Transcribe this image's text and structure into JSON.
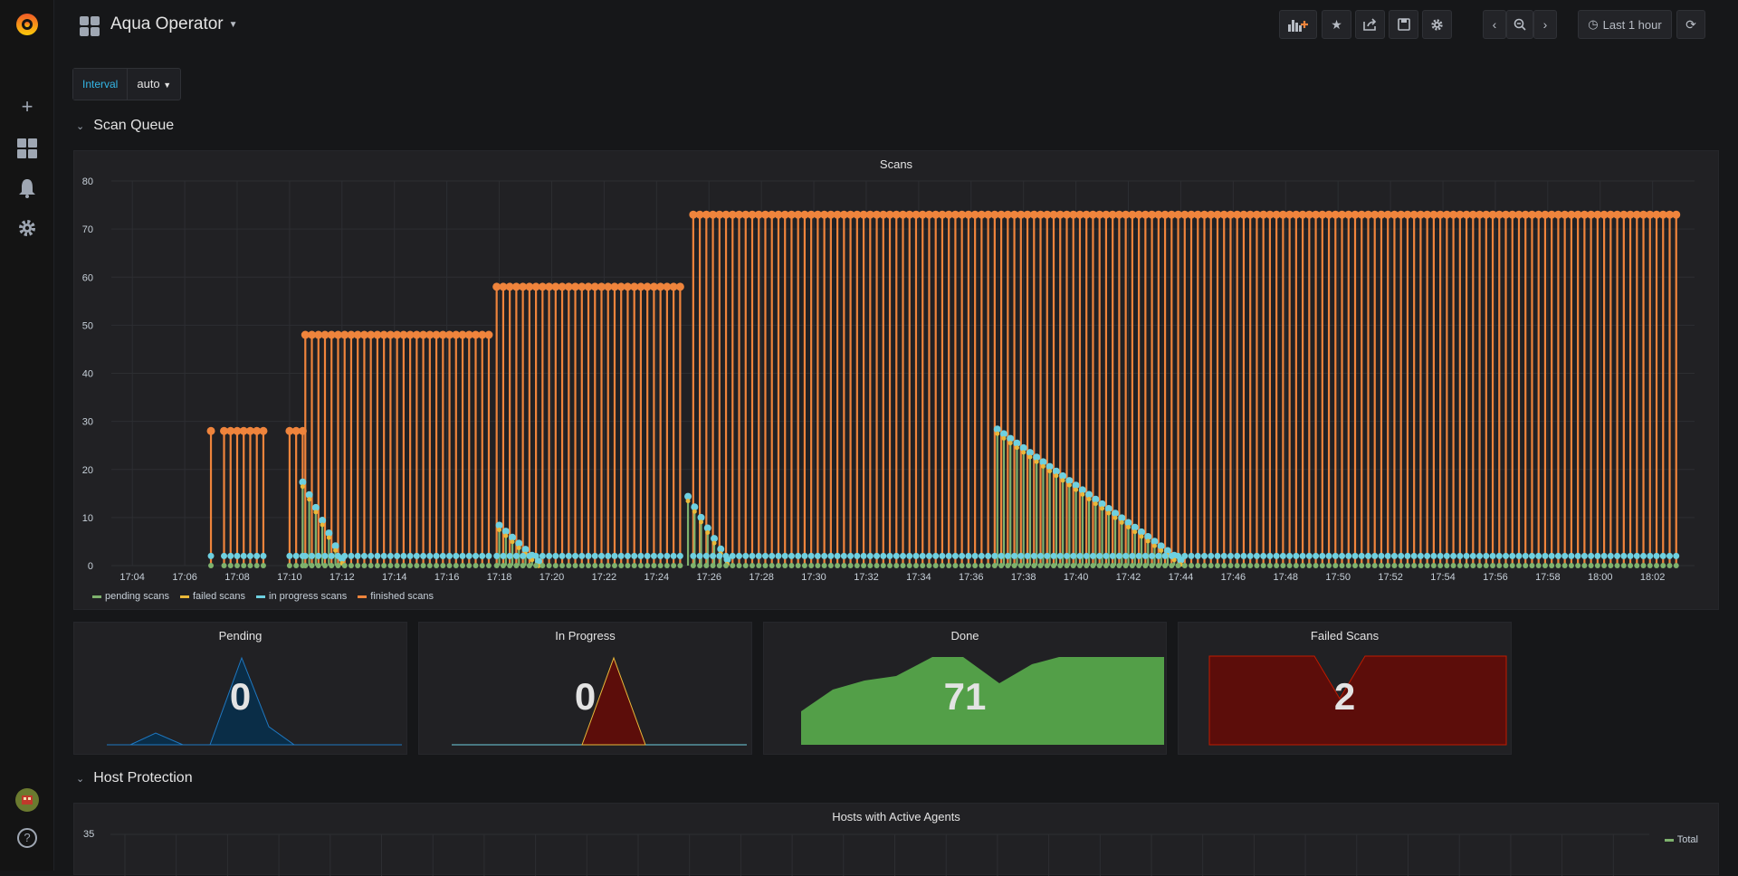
{
  "sidebar": {
    "logo": "grafana-logo",
    "items": [
      {
        "name": "create",
        "icon": "plus-icon",
        "glyph": "+"
      },
      {
        "name": "dashboards",
        "icon": "dashboards-icon"
      },
      {
        "name": "alerting",
        "icon": "bell-icon"
      },
      {
        "name": "configuration",
        "icon": "gear-icon"
      }
    ],
    "help_glyph": "?"
  },
  "header": {
    "title": "Aqua Operator",
    "time_range": "Last 1 hour"
  },
  "variables": {
    "interval_label": "Interval",
    "interval_value": "auto"
  },
  "rows": {
    "scan_queue": "Scan Queue",
    "host_protection": "Host Protection"
  },
  "panels": {
    "scans_title": "Scans",
    "pending": {
      "title": "Pending",
      "value": "0"
    },
    "in_progress": {
      "title": "In Progress",
      "value": "0"
    },
    "done": {
      "title": "Done",
      "value": "71"
    },
    "failed": {
      "title": "Failed Scans",
      "value": "2"
    },
    "hosts_title": "Hosts with Active Agents",
    "hosts_y_top": "35",
    "hosts_legend": "Total"
  },
  "colors": {
    "pending": "#7eb26d",
    "failed": "#eab839",
    "in_progress": "#6ed0e0",
    "finished": "#ef843c",
    "blue": "#1f78c1",
    "red": "#890f02",
    "green": "#629e51",
    "dark_red": "#5c0d0a"
  },
  "chart_data": {
    "type": "bar",
    "title": "Scans",
    "ylim": [
      0,
      80
    ],
    "y_ticks": [
      0,
      10,
      20,
      30,
      40,
      50,
      60,
      70,
      80
    ],
    "x_ticks": [
      "17:04",
      "17:06",
      "17:08",
      "17:10",
      "17:12",
      "17:14",
      "17:16",
      "17:18",
      "17:20",
      "17:22",
      "17:24",
      "17:26",
      "17:28",
      "17:30",
      "17:32",
      "17:34",
      "17:36",
      "17:38",
      "17:40",
      "17:42",
      "17:44",
      "17:46",
      "17:48",
      "17:50",
      "17:52",
      "17:54",
      "17:56",
      "17:58",
      "18:00",
      "18:02"
    ],
    "legend": [
      {
        "name": "pending scans",
        "color": "#7eb26d"
      },
      {
        "name": "failed scans",
        "color": "#eab839"
      },
      {
        "name": "in progress scans",
        "color": "#6ed0e0"
      },
      {
        "name": "finished scans",
        "color": "#ef843c"
      }
    ],
    "finished_segments": [
      {
        "from": "17:07",
        "to": "17:07",
        "value": 28
      },
      {
        "from": "17:07.5",
        "to": "17:09",
        "value": 28
      },
      {
        "from": "17:10",
        "to": "17:10.5",
        "value": 28
      },
      {
        "from": "17:10.6",
        "to": "17:17.7",
        "value": 48
      },
      {
        "from": "17:17.9",
        "to": "17:24.9",
        "value": 58
      },
      {
        "from": "17:25.4",
        "to": "18:03",
        "value": 73
      }
    ],
    "pending_peaks": [
      {
        "at": "17:10.5",
        "value": 17
      },
      {
        "at": "17:18",
        "value": 8
      },
      {
        "at": "17:25.2",
        "value": 14
      },
      {
        "at": "17:37",
        "value": 28
      }
    ]
  }
}
